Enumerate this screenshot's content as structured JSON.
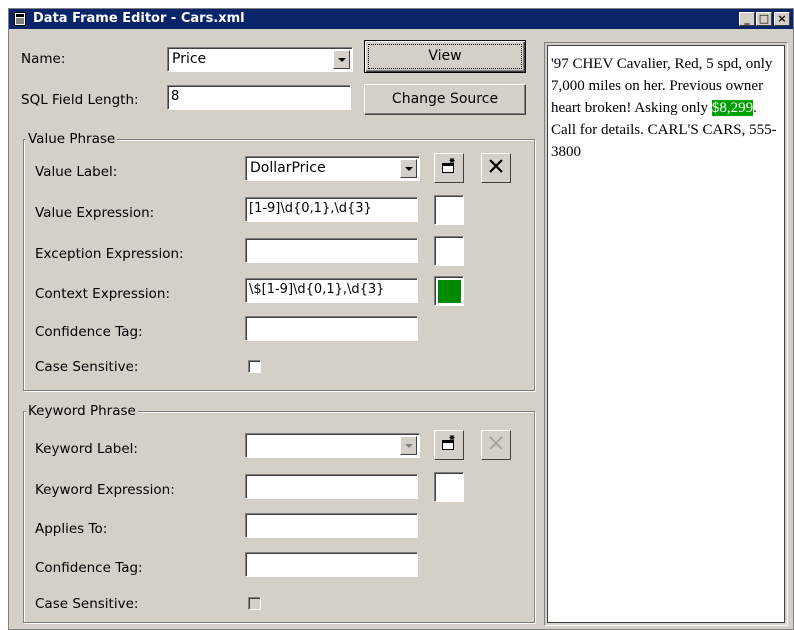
{
  "window": {
    "title": "Data Frame Editor - Cars.xml",
    "title_icon": "document-icon",
    "controls": [
      "_",
      "□",
      "×"
    ]
  },
  "header": {
    "name_label": "Name:",
    "name_value": "Price",
    "sql_label": "SQL Field Length:",
    "sql_value": "8",
    "view_button": "View",
    "change_source_button": "Change Source"
  },
  "value_phrase": {
    "legend": "Value Phrase",
    "value_label_label": "Value Label:",
    "value_label_value": "DollarPrice",
    "value_expression_label": "Value Expression:",
    "value_expression_value": "[1-9]\\d{0,1},\\d{3}",
    "exception_expression_label": "Exception Expression:",
    "exception_expression_value": "",
    "context_expression_label": "Context Expression:",
    "context_expression_value": "\\$[1-9]\\d{0,1},\\d{3}",
    "confidence_tag_label": "Confidence Tag:",
    "confidence_tag_value": "",
    "case_sensitive_label": "Case Sensitive:",
    "case_sensitive_checked": false,
    "context_color": "#008a00"
  },
  "keyword_phrase": {
    "legend": "Keyword Phrase",
    "keyword_label_label": "Keyword Label:",
    "keyword_label_value": "",
    "keyword_expression_label": "Keyword Expression:",
    "keyword_expression_value": "",
    "applies_to_label": "Applies To:",
    "applies_to_value": "",
    "confidence_tag_label": "Confidence Tag:",
    "confidence_tag_value": "",
    "case_sensitive_label": "Case Sensitive:",
    "case_sensitive_checked": false
  },
  "source_text": {
    "before": "'97 CHEV Cavalier, Red, 5 spd, only 7,000 miles on her. Previous owner heart broken! Asking only ",
    "highlight": "$8,299",
    "after": ". Call for details. CARL'S CARS, 555-3800",
    "highlight_color": "#00a000"
  }
}
